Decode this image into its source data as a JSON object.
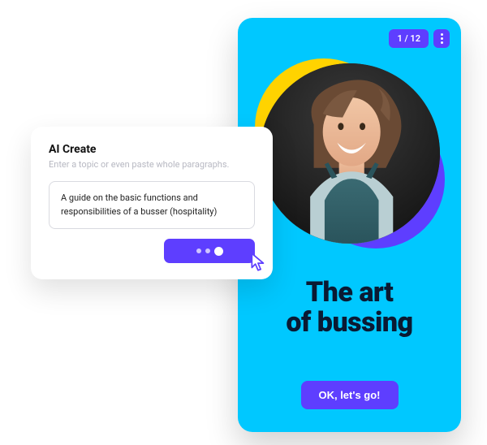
{
  "colors": {
    "accent": "#5e3eff",
    "phone_bg": "#00c8ff",
    "yellow": "#ffd300"
  },
  "card": {
    "title": "AI Create",
    "hint": "Enter a topic or even paste whole paragraphs.",
    "topic_value": "A guide on the basic functions and responsibilities of a busser (hospitality)",
    "generate_icon": "loading-dots"
  },
  "phone": {
    "page_indicator": "1 / 12",
    "menu_icon": "kebab-icon",
    "title_line1": "The art",
    "title_line2": "of bussing",
    "cta_label": "OK, let's go!"
  }
}
